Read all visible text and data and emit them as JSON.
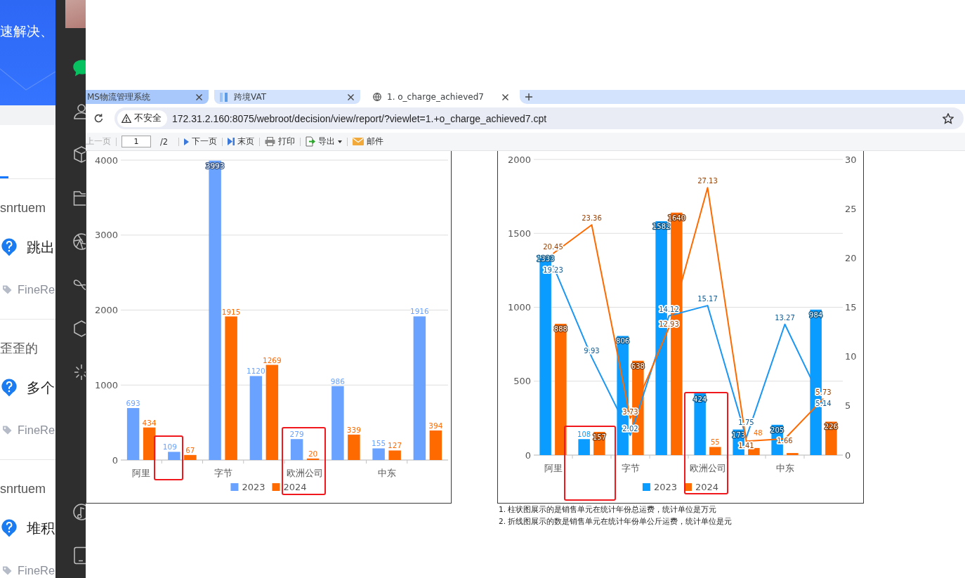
{
  "background_page": {
    "banner": "速解决、",
    "questions": [
      {
        "author": "snrtuem",
        "title": "跳出",
        "tag": "FineRe"
      },
      {
        "author": "歪歪的",
        "title": "多个",
        "tag": "FineRe"
      },
      {
        "author": "snrtuem",
        "title": "堆积",
        "tag": "FineRe"
      }
    ]
  },
  "dock": {
    "items": [
      {
        "kind": "chat",
        "selected": true
      },
      {
        "kind": "contacts",
        "selected": false
      },
      {
        "kind": "box",
        "selected": false
      },
      {
        "kind": "folder",
        "selected": false
      },
      {
        "kind": "aperture",
        "selected": false
      },
      {
        "kind": "loop",
        "selected": false
      },
      {
        "kind": "hexagon",
        "selected": false
      },
      {
        "kind": "spinner",
        "selected": false
      }
    ],
    "bottom_items": [
      {
        "kind": "music",
        "selected": false
      },
      {
        "kind": "phone",
        "selected": false
      }
    ]
  },
  "browser": {
    "tabs": [
      {
        "kind": "plain",
        "title": "MS物流管理系统",
        "selected": false,
        "highlighted": true
      },
      {
        "kind": "app",
        "title": "跨境VAT",
        "selected": false,
        "highlighted": false
      },
      {
        "kind": "web",
        "title": "1. o_charge_achieved7",
        "selected": true,
        "highlighted": false
      }
    ],
    "security_label": "不安全",
    "url": "172.31.2.160:8075/webroot/decision/view/report/?viewlet=1.+o_charge_achieved7.cpt"
  },
  "report": {
    "toolbar": [
      {
        "kind": "prev",
        "label": "上一页",
        "disabled": true
      },
      {
        "kind": "page",
        "value": "1",
        "total": "/2"
      },
      {
        "kind": "next",
        "label": "下一页",
        "disabled": false
      },
      {
        "kind": "last",
        "label": "末页",
        "disabled": false
      },
      {
        "kind": "print",
        "label": "打印",
        "disabled": false
      },
      {
        "kind": "export",
        "label": "导出",
        "disabled": false
      },
      {
        "kind": "mail",
        "label": "邮件",
        "disabled": false
      }
    ],
    "charts": [
      {
        "chart_data": {
          "type": "bar",
          "categories": [
            "阿里",
            null,
            "字节",
            null,
            "欧洲公司",
            null,
            "中东",
            null
          ],
          "ylim": [
            0,
            4000
          ],
          "yticks": [
            0,
            1000,
            2000,
            3000,
            4000
          ],
          "grid": true,
          "legend": true,
          "data_labels": true,
          "series": [
            {
              "name": "2023",
              "color": "#6aa3ff",
              "values": [
                693,
                109,
                3993,
                1120,
                279,
                986,
                155,
                1916
              ]
            },
            {
              "name": "2024",
              "color": "#ff6a00",
              "values": [
                434,
                67,
                1915,
                1269,
                20,
                339,
                127,
                394
              ]
            }
          ]
        }
      },
      {
        "chart_data": {
          "type": "bar",
          "categories": [
            "阿里",
            null,
            "字节",
            null,
            "欧洲公司",
            null,
            "中东",
            null
          ],
          "ylim": [
            0,
            2000
          ],
          "yticks": [
            0,
            500,
            1000,
            1500,
            2000
          ],
          "grid": true,
          "legend": true,
          "value_labels": [
            [
              "1333",
              "108",
              "806",
              "1582",
              "424",
              "173",
              "205",
              "984"
            ],
            [
              "888",
              "157",
              "638",
              "1640",
              "55",
              "48",
              null,
              "226"
            ]
          ],
          "series": [
            {
              "name": "2023",
              "color": "#0a9dff",
              "values": [
                1333,
                108,
                806,
                1582,
                424,
                173,
                205,
                984
              ]
            },
            {
              "name": "2024",
              "color": "#ff6a00",
              "values": [
                888,
                157,
                638,
                1640,
                55,
                48,
                14,
                226
              ]
            }
          ]
        },
        "line_overlay": {
          "chart_data": {
            "type": "line",
            "ylim": [
              0,
              30
            ],
            "yticks": [
              0,
              5,
              10,
              15,
              20,
              25,
              30
            ],
            "data_labels": true,
            "series": [
              {
                "color": "#1a96f5",
                "values": [
                  19.23,
                  9.93,
                  2.02,
                  14.12,
                  15.17,
                  1.75,
                  13.27,
                  5.14
                ]
              },
              {
                "color": "#ff6a00",
                "values": [
                  20.45,
                  23.36,
                  3.73,
                  12.93,
                  27.13,
                  1.41,
                  1.66,
                  5.73
                ]
              }
            ]
          }
        },
        "notes": [
          "1. 柱状图展示的是销售单元在统计年份总运费，统计单位是万元",
          "2. 折线图展示的数是销售单元在统计年份单公斤运费，统计单位是元"
        ]
      }
    ]
  }
}
